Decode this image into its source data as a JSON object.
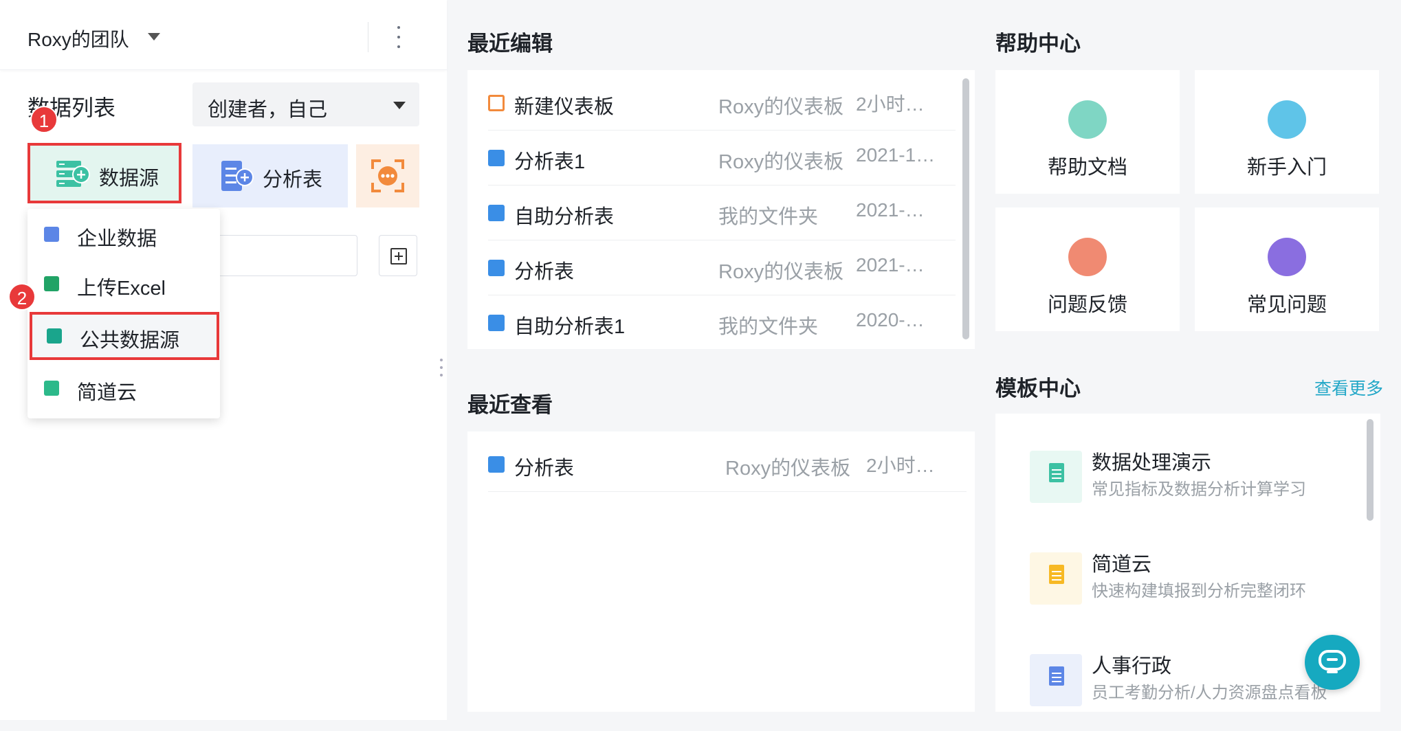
{
  "colors": {
    "accent": "#16a9c0",
    "highlight_border": "#e8393a",
    "muted_text": "#9aa0a6"
  },
  "left_panel": {
    "team_name": "Roxy的团队",
    "team_caret_icon": "caret-down-icon",
    "menu_icon": "more-vertical-icon",
    "list_title": "数据列表",
    "creator_filter": "创建者，自己",
    "buttons": {
      "datasource": "数据源",
      "analysis_table": "分析表"
    },
    "dropdown": [
      {
        "label": "企业数据",
        "icon": "building-icon"
      },
      {
        "label": "上传Excel",
        "icon": "excel-icon"
      },
      {
        "label": "公共数据源",
        "icon": "table-list-icon"
      },
      {
        "label": "简道云",
        "icon": "cloud-icon"
      }
    ],
    "steps": [
      "1",
      "2"
    ]
  },
  "recent_edit": {
    "title": "最近编辑",
    "rows": [
      {
        "name": "新建仪表板",
        "folder": "Roxy的仪表板",
        "time": "2小时…",
        "icon": "dashboard-icon"
      },
      {
        "name": "分析表1",
        "folder": "Roxy的仪表板",
        "time": "2021-1…",
        "icon": "analysis-table-icon"
      },
      {
        "name": "自助分析表",
        "folder": "我的文件夹",
        "time": "2021-…",
        "icon": "analysis-table-icon"
      },
      {
        "name": "分析表",
        "folder": "Roxy的仪表板",
        "time": "2021-…",
        "icon": "analysis-table-icon"
      },
      {
        "name": "自助分析表1",
        "folder": "我的文件夹",
        "time": "2020-…",
        "icon": "analysis-table-icon"
      }
    ]
  },
  "recent_view": {
    "title": "最近查看",
    "rows": [
      {
        "name": "分析表",
        "folder": "Roxy的仪表板",
        "time": "2小时…",
        "icon": "analysis-table-icon"
      }
    ]
  },
  "help_center": {
    "title": "帮助中心",
    "tiles": [
      {
        "label": "帮助文档",
        "icon": "bookmark-doc-icon",
        "color": "#7fd6c4"
      },
      {
        "label": "新手入门",
        "icon": "signpost-icon",
        "color": "#5fc4e8"
      },
      {
        "label": "问题反馈",
        "icon": "feedback-icon",
        "color": "#f08a72"
      },
      {
        "label": "常见问题",
        "icon": "question-icon",
        "color": "#8a6ee0"
      }
    ]
  },
  "template_center": {
    "title": "模板中心",
    "more_link": "查看更多",
    "items": [
      {
        "title": "数据处理演示",
        "desc": "常见指标及数据分析计算学习",
        "color": "#3cc1a3",
        "bg": "#e8f8f3"
      },
      {
        "title": "简道云",
        "desc": "快速构建填报到分析完整闭环",
        "color": "#f7b924",
        "bg": "#fef7e4"
      },
      {
        "title": "人事行政",
        "desc": "员工考勤分析/人力资源盘点看板",
        "color": "#5c86e6",
        "bg": "#ebf0fb"
      }
    ]
  },
  "support_fab_icon": "chat-support-icon"
}
